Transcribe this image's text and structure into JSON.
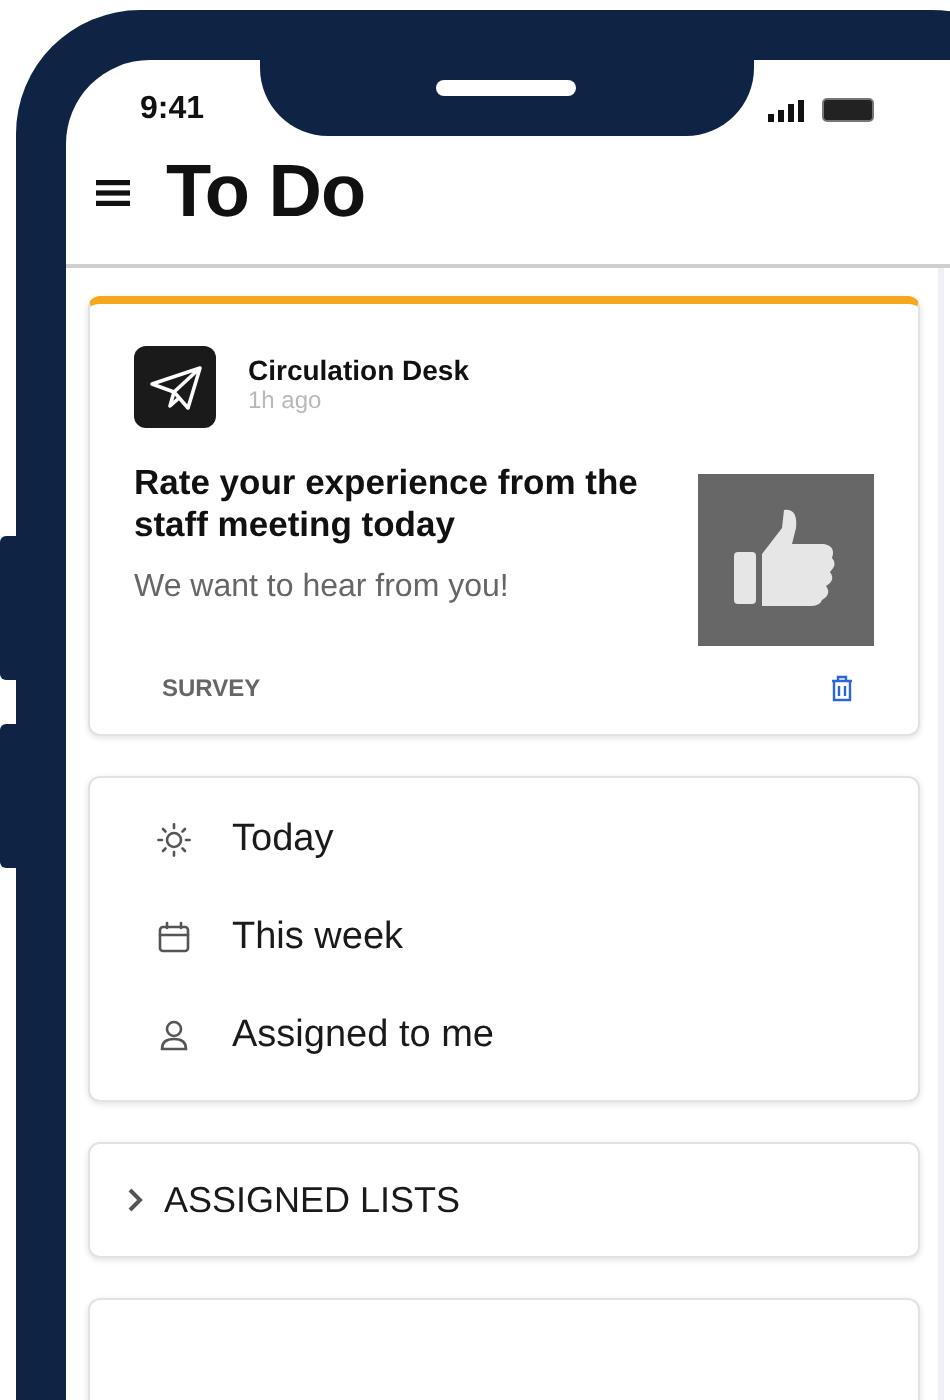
{
  "status_bar": {
    "time": "9:41"
  },
  "header": {
    "title": "To Do"
  },
  "survey_card": {
    "source": "Circulation Desk",
    "time": "1h ago",
    "title": "Rate your experience from the staff meeting today",
    "subtitle": "We want to hear from you!",
    "tag": "SURVEY"
  },
  "filters": [
    {
      "kind": "today",
      "label": "Today"
    },
    {
      "kind": "week",
      "label": "This week"
    },
    {
      "kind": "assigned",
      "label": "Assigned to me"
    }
  ],
  "sections": [
    {
      "label": "ASSIGNED LISTS",
      "expanded": false
    }
  ]
}
